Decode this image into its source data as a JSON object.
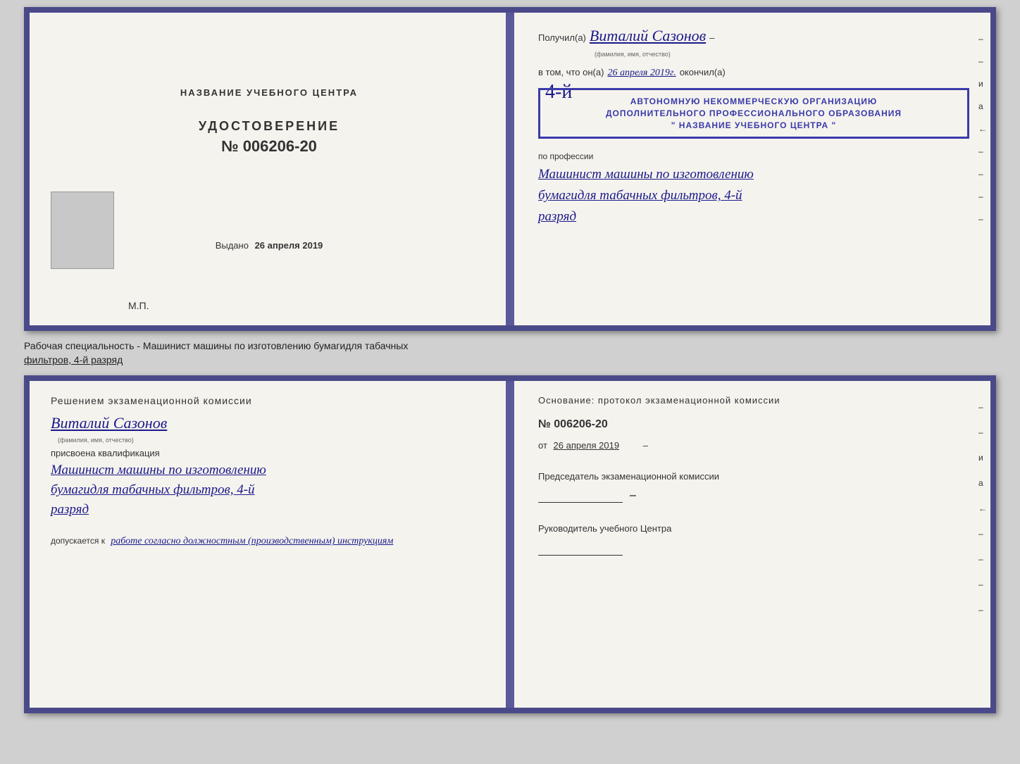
{
  "topDoc": {
    "leftPage": {
      "title": "НАЗВАНИЕ УЧЕБНОГО ЦЕНТРА",
      "certLabel": "УДОСТОВЕРЕНИЕ",
      "certNumber": "№ 006206-20",
      "issuedPrefix": "Выдано",
      "issuedDate": "26 апреля 2019",
      "mpLabel": "М.П."
    },
    "rightPage": {
      "recipientPrefix": "Получил(а)",
      "recipientName": "Виталий Сазонов",
      "recipientSubtitle": "(фамилия, имя, отчество)",
      "vtomPrefix": "в том, что он(а)",
      "vtomDate": "26 апреля 2019г.",
      "vtomSuffix": "окончил(а)",
      "stampNumberOverlay": "4-й",
      "stampLine1": "АВТОНОМНУЮ НЕКОММЕРЧЕСКУЮ ОРГАНИЗАЦИЮ",
      "stampLine2": "ДОПОЛНИТЕЛЬНОГО ПРОФЕССИОНАЛЬНОГО ОБРАЗОВАНИЯ",
      "stampLine3": "\" НАЗВАНИЕ УЧЕБНОГО ЦЕНТРА \"",
      "professionLabel": "по профессии",
      "professionLine1": "Машинист машины по изготовлению",
      "professionLine2": "бумагидля табачных фильтров, 4-й",
      "professionLine3": "разряд"
    }
  },
  "separatorText": {
    "line1": "Рабочая специальность - Машинист машины по изготовлению бумагидля табачных",
    "line2": "фильтров, 4-й разряд"
  },
  "bottomDoc": {
    "leftPage": {
      "decisionTitle": "Решением  экзаменационной  комиссии",
      "personName": "Виталий Сазонов",
      "personSubtitle": "(фамилия, имя, отчество)",
      "qualLabel": "присвоена квалификация",
      "qualLine1": "Машинист машины по изготовлению",
      "qualLine2": "бумагидля табачных фильтров, 4-й",
      "qualLine3": "разряд",
      "workPrefix": "допускается к",
      "workText": "работе согласно должностным (производственным) инструкциям"
    },
    "rightPage": {
      "basisLabel": "Основание:  протокол  экзаменационной  комиссии",
      "protocolNumber": "№  006206-20",
      "fromPrefix": "от",
      "fromDate": "26 апреля 2019",
      "chairLabel": "Председатель экзаменационной комиссии",
      "headLabel": "Руководитель учебного Центра"
    }
  },
  "sideMarks": [
    "-",
    "–",
    "и",
    "а",
    "←",
    "-",
    "-",
    "-"
  ]
}
